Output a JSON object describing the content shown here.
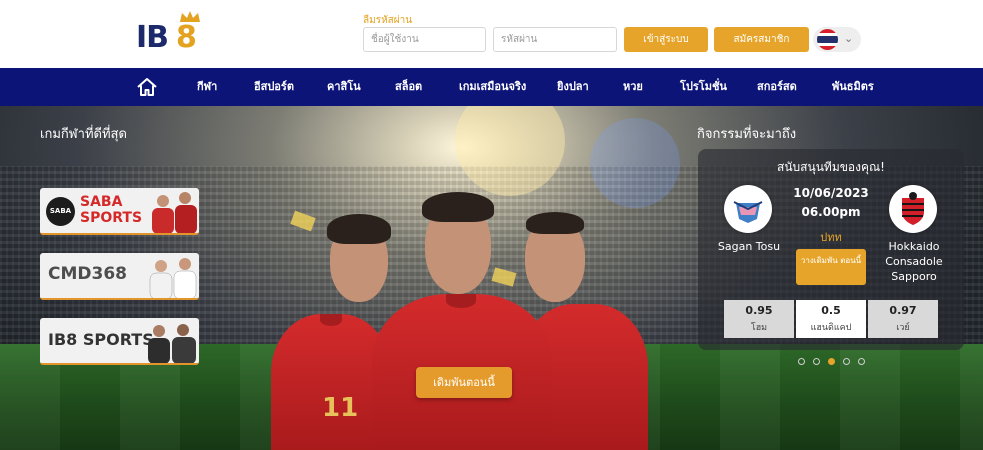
{
  "brand": {
    "logo_text_ib": "IB",
    "logo_text_8": "8"
  },
  "login": {
    "forgot_label": "ลืมรหัสผ่าน",
    "username_placeholder": "ชื่อผู้ใช้งาน",
    "password_placeholder": "รหัสผ่าน",
    "login_label": "เข้าสู่ระบบ",
    "register_label": "สมัครสมาชิก"
  },
  "language": {
    "flag_icon": "thailand-flag-icon",
    "chevron_icon": "chevron-down-icon"
  },
  "nav": {
    "home_icon": "home-icon",
    "items": [
      "กีฬา",
      "อีสปอร์ต",
      "คาสิโน",
      "สล็อต",
      "เกมเสมือนจริง",
      "ยิงปลา",
      "หวย",
      "โปรโมชั่น",
      "สกอร์สด",
      "พันธมิตร"
    ]
  },
  "hero": {
    "left_title": "เกมกีฬาที่ดีที่สุด",
    "right_title": "กิจกรรมที่จะมาถึง",
    "providers": [
      {
        "badge": "SABA",
        "name_line1": "SABA",
        "name_line2": "SPORTS"
      },
      {
        "name": "CMD368"
      },
      {
        "name": "IB8 SPORTS"
      }
    ],
    "player_number": "11",
    "cta_label": "เดิมพันตอนนี้",
    "accent": "#e6a52a"
  },
  "match": {
    "title": "สนับสนุนทีมของคุณ!",
    "date": "10/06/2023",
    "time": "06.00pm",
    "league": "ปทท",
    "home_team": "Sagan Tosu",
    "away_team": "Hokkaido Consadole Sapporo",
    "bet_label": "วางเดิมพัน ตอนนี้",
    "odds": [
      {
        "value": "0.95",
        "label": "โฮม"
      },
      {
        "value": "0.5",
        "label": "แฮนดิแคป"
      },
      {
        "value": "0.97",
        "label": "เวย์"
      }
    ]
  },
  "carousel": {
    "count": 5,
    "active_index": 2
  }
}
